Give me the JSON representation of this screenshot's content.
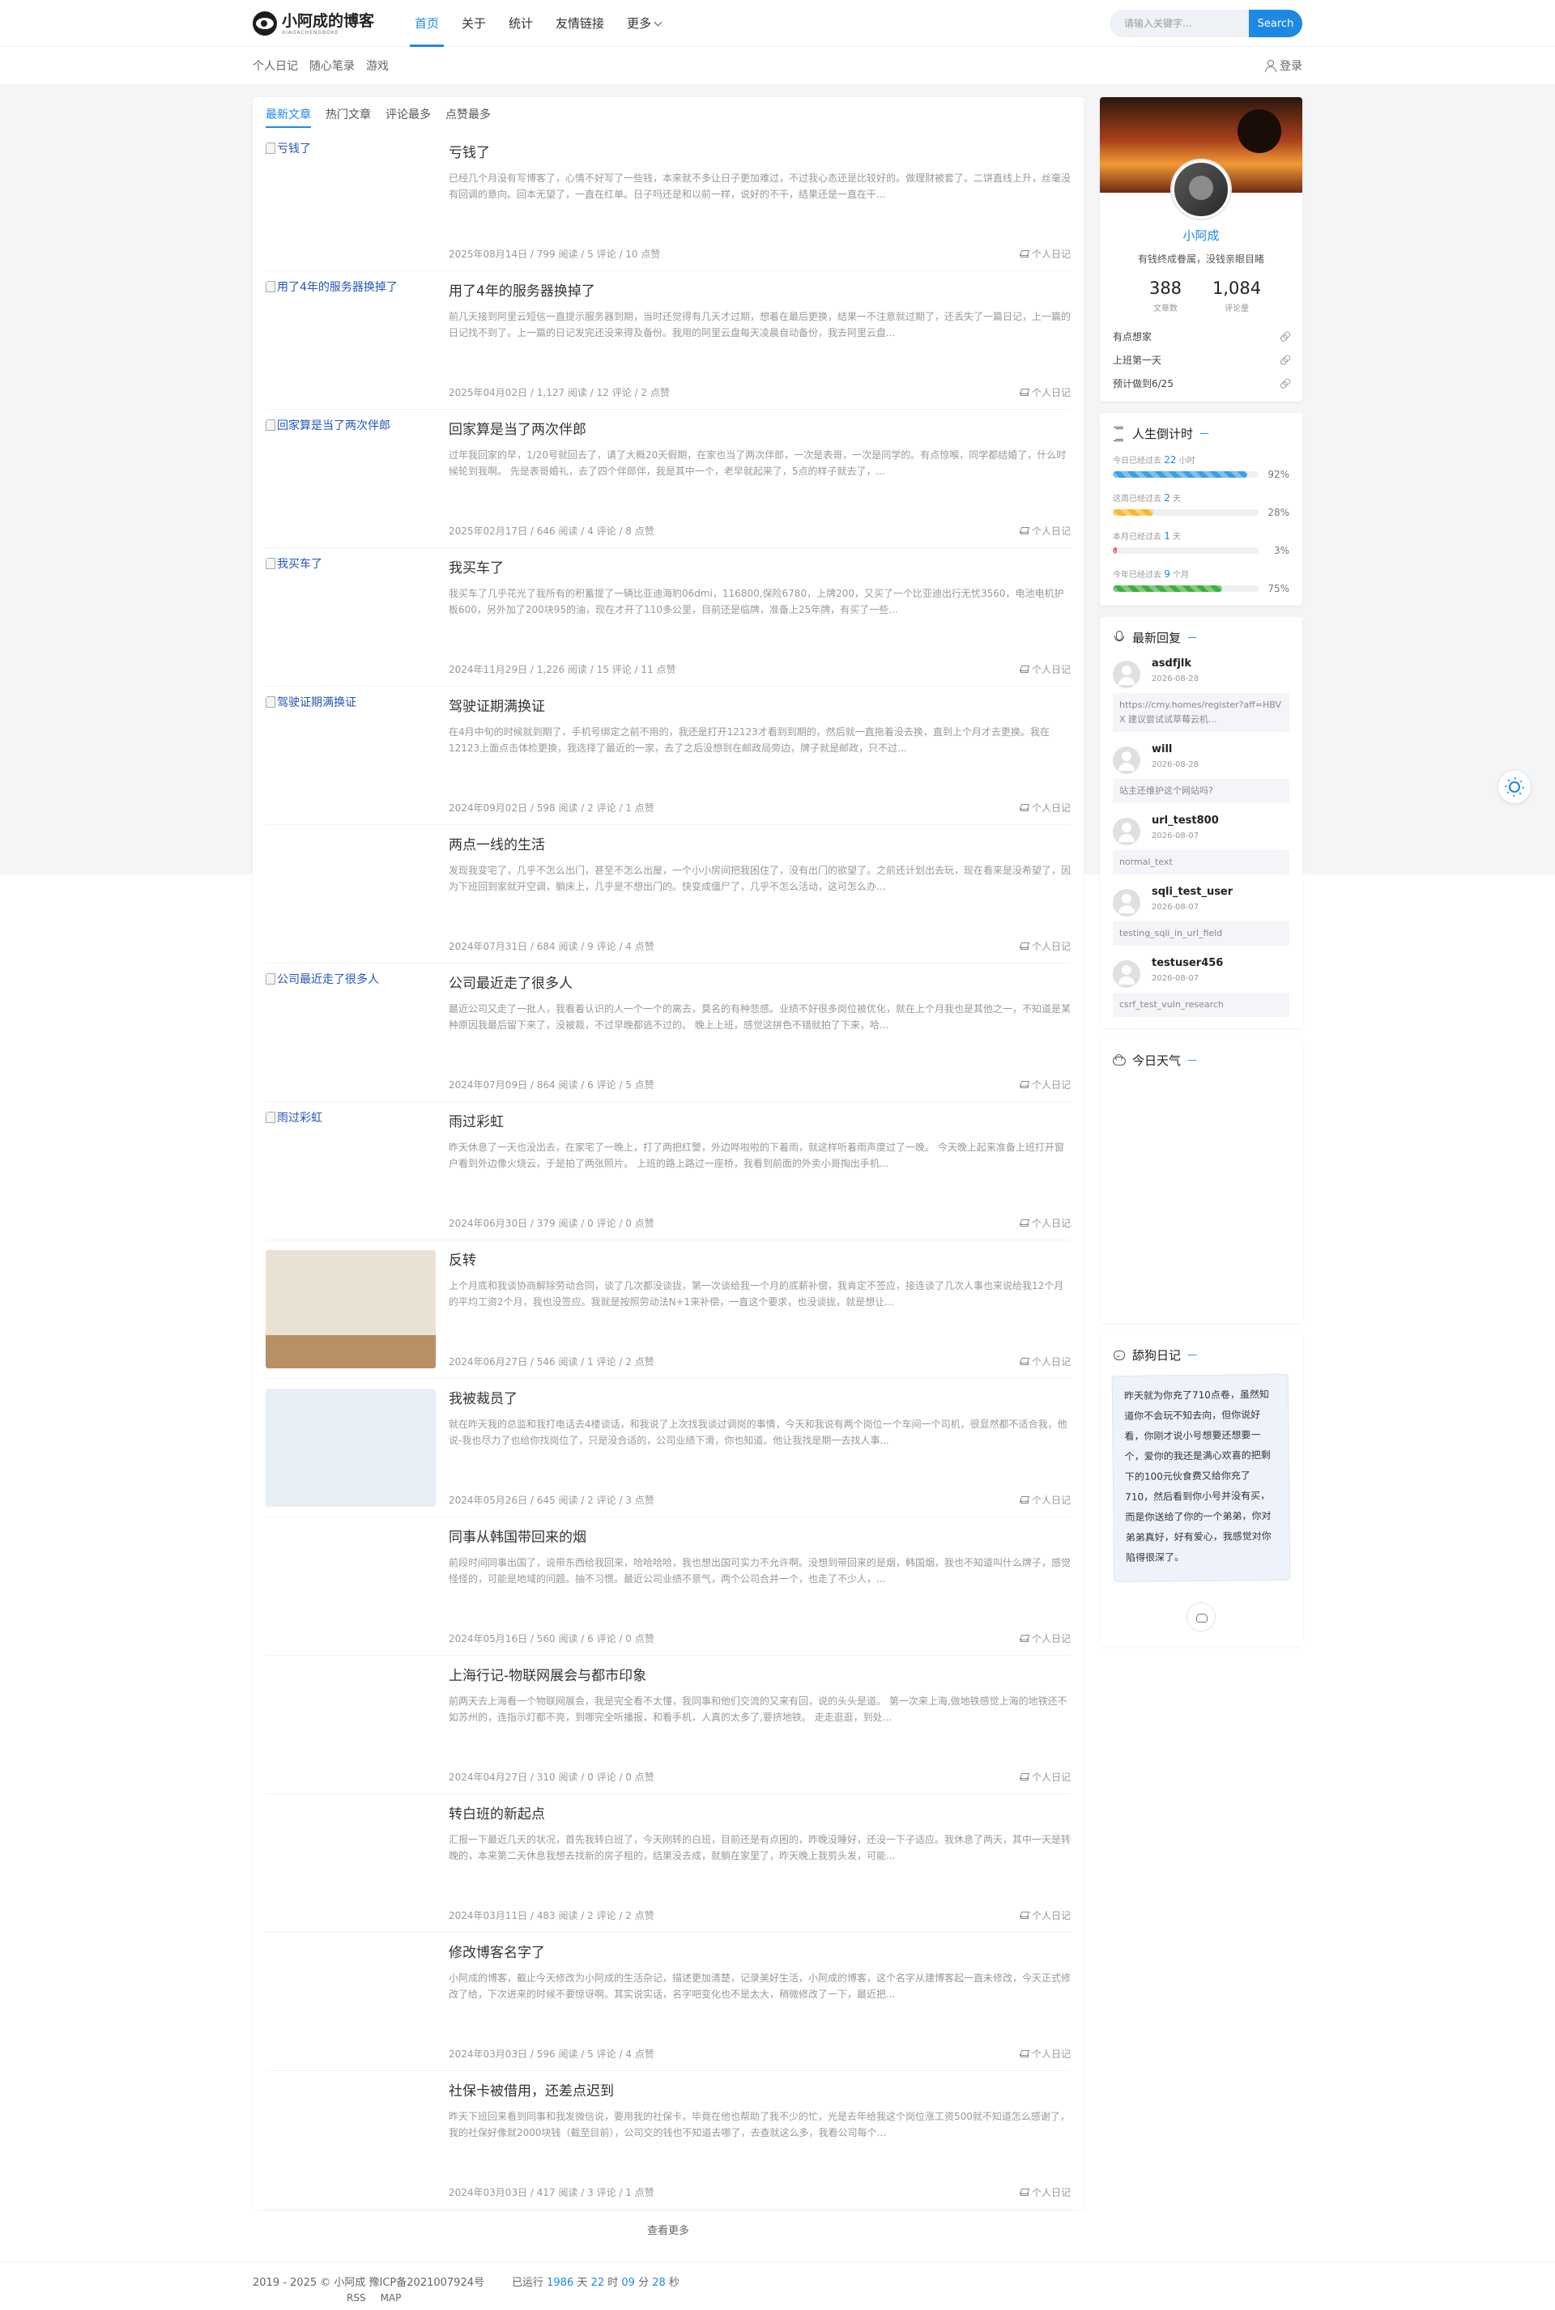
{
  "header": {
    "logo_title": "小阿成的博客",
    "logo_sub": "XIAOACHENGBOKE",
    "nav": [
      {
        "label": "首页",
        "active": true
      },
      {
        "label": "关于"
      },
      {
        "label": "统计"
      },
      {
        "label": "友情链接"
      },
      {
        "label": "更多"
      }
    ],
    "search_placeholder": "请输入关键字...",
    "search_button": "Search"
  },
  "subnav": {
    "items": [
      "个人日记",
      "随心笔录",
      "游戏"
    ],
    "login": "登录"
  },
  "tabs": [
    "最新文章",
    "热门文章",
    "评论最多",
    "点赞最多"
  ],
  "posts": [
    {
      "thumb_alt": "亏钱了",
      "thumb": "broken",
      "title": "亏钱了",
      "excerpt": "已经几个月没有写博客了，心情不好写了一些钱，本来就不多让日子更加难过，不过我心态还是比较好的。做理财被套了。二饼直线上升，丝毫没有回调的意向。回本无望了，一直在红单。日子吗还是和以前一样，说好的不干，结果还是一直在干...",
      "date": "2025年08月14日",
      "views": "799 阅读",
      "comments": "5 评论",
      "likes": "10 点赞",
      "category": "个人日记"
    },
    {
      "thumb_alt": "用了4年的服务器换掉了",
      "thumb": "broken",
      "title": "用了4年的服务器换掉了",
      "excerpt": "前几天接到阿里云短信一直提示服务器到期，当时还觉得有几天才过期，想着在最后更换，结果一不注意就过期了，还丢失了一篇日记，上一篇的日记找不到了。上一篇的日记发完还没来得及备份。我用的阿里云盘每天凌晨自动备份，我去阿里云盘...",
      "date": "2025年04月02日",
      "views": "1,127 阅读",
      "comments": "12 评论",
      "likes": "2 点赞",
      "category": "个人日记"
    },
    {
      "thumb_alt": "回家算是当了两次伴郎",
      "thumb": "broken",
      "title": "回家算是当了两次伴郎",
      "excerpt": "过年我回家的早，1/20号就回去了，请了大概20天假期，在家也当了两次伴郎，一次是表哥，一次是同学的。有点惊喉，同学都结婚了，什么时候轮到我啊。 先是表哥婚礼，去了四个伴郎伴，我是其中一个，老早就起来了，5点的样子就去了，...",
      "date": "2025年02月17日",
      "views": "646 阅读",
      "comments": "4 评论",
      "likes": "8 点赞",
      "category": "个人日记"
    },
    {
      "thumb_alt": "我买车了",
      "thumb": "broken",
      "title": "我买车了",
      "excerpt": "我买车了几乎花光了我所有的积蓄提了一辆比亚迪海豹06dmi，116800,保险6780，上牌200，又买了一个比亚迪出行无忧3560，电池电机护板600，另外加了200块95的油，现在才开了110多公里，目前还是临牌，准备上25年牌，有买了一些...",
      "date": "2024年11月29日",
      "views": "1,226 阅读",
      "comments": "15 评论",
      "likes": "11 点赞",
      "category": "个人日记"
    },
    {
      "thumb_alt": "驾驶证期满换证",
      "thumb": "broken",
      "title": "驾驶证期满换证",
      "excerpt": "在4月中旬的时候就到期了，手机号绑定之前不用的，我还是打开12123才看到到期的，然后就一直拖着没去换，直到上个月才去更换。我在12123上面点击体检更换，我选择了最近的一家，去了之后没想到在邮政局旁边，牌子就是邮政，只不过...",
      "date": "2024年09月02日",
      "views": "598 阅读",
      "comments": "2 评论",
      "likes": "1 点赞",
      "category": "个人日记"
    },
    {
      "thumb_alt": "两点一线的生活",
      "thumb": "art1",
      "title": "两点一线的生活",
      "excerpt": "发现我变宅了，几乎不怎么出门，甚至不怎么出屋，一个小小房间把我困住了，没有出门的欲望了。之前还计划出去玩，现在看来是没希望了，因为下班回到家就开空调，躺床上，几乎是不想出门的。快变成僵尸了，几乎不怎么活动，这可怎么办...",
      "date": "2024年07月31日",
      "views": "684 阅读",
      "comments": "9 评论",
      "likes": "4 点赞",
      "category": "个人日记"
    },
    {
      "thumb_alt": "公司最近走了很多人",
      "thumb": "broken",
      "title": "公司最近走了很多人",
      "excerpt": "最近公司又走了一批人，我看着认识的人一个一个的离去，莫名的有种悲感。业绩不好很多岗位被优化，就在上个月我也是其他之一，不知道是某种原因我最后留下来了，没被裁，不过早晚都逃不过的。 晚上上班，感觉这拼色不错就拍了下来，哈...",
      "date": "2024年07月09日",
      "views": "864 阅读",
      "comments": "6 评论",
      "likes": "5 点赞",
      "category": "个人日记"
    },
    {
      "thumb_alt": "雨过彩虹",
      "thumb": "broken",
      "title": "雨过彩虹",
      "excerpt": "昨天休息了一天也没出去，在家宅了一晚上，打了两把红警，外边哗啦啦的下着雨，就这样听着雨声度过了一晚。 今天晚上起来准备上班打开窗户看到外边像火烧云，于是拍了两张照片。 上班的路上路过一座桥，我看到前面的外卖小哥掏出手机...",
      "date": "2024年06月30日",
      "views": "379 阅读",
      "comments": "0 评论",
      "likes": "0 点赞",
      "category": "个人日记"
    },
    {
      "thumb_alt": "反转",
      "thumb": "art2",
      "title": "反转",
      "excerpt": "上个月底和我谈协商解除劳动合同，谈了几次都没谈拢，第一次谈给我一个月的底薪补偿，我肯定不签应，接连谈了几次人事也来说给我12个月的平均工资2个月，我也没签应。我就是按照劳动法N+1来补偿，一直这个要求，也没谈拢，就是想让...",
      "date": "2024年06月27日",
      "views": "546 阅读",
      "comments": "1 评论",
      "likes": "2 点赞",
      "category": "个人日记"
    },
    {
      "thumb_alt": "我被裁员了",
      "thumb": "art3",
      "title": "我被裁员了",
      "excerpt": "就在昨天我的总监和我打电话去4楼谈话，和我说了上次找我谈过调岗的事情，今天和我说有两个岗位一个车间一个司机，很显然都不适合我，他说-我也尽力了也给你找岗位了，只是没合适的，公司业绩下滑，你也知道。他让我找是期一去找人事...",
      "date": "2024年05月26日",
      "views": "645 阅读",
      "comments": "2 评论",
      "likes": "3 点赞",
      "category": "个人日记"
    },
    {
      "thumb_alt": "",
      "thumb": "none",
      "title": "同事从韩国带回来的烟",
      "excerpt": "前段时间同事出国了，说带东西给我回来，哈哈哈哈，我也想出国可实力不允许啊。没想到带回来的是烟，韩国烟，我也不知道叫什么牌子，感觉怪怪的，可能是地域的问题。抽不习惯。最近公司业绩不景气，两个公司合并一个，也走了不少人，...",
      "date": "2024年05月16日",
      "views": "560 阅读",
      "comments": "6 评论",
      "likes": "0 点赞",
      "category": "个人日记"
    },
    {
      "thumb_alt": "",
      "thumb": "none",
      "title": "上海行记-物联网展会与都市印象",
      "excerpt": "前两天去上海看一个物联网展会，我是完全看不太懂，我同事和他们交流的又来有回，说的头头是道。 第一次来上海,做地铁感觉上海的地铁还不如苏州的，连指示灯都不亮，到哪完全听播报，和看手机，人真的太多了,要挤地铁。 走走逛逛，到处...",
      "date": "2024年04月27日",
      "views": "310 阅读",
      "comments": "0 评论",
      "likes": "0 点赞",
      "category": "个人日记"
    },
    {
      "thumb_alt": "",
      "thumb": "none",
      "title": "转白班的新起点",
      "excerpt": "汇报一下最近几天的状况，首先我转白班了，今天刚转的白班，目前还是有点困的，昨晚没睡好，还没一下子适应。我休息了两天，其中一天是转晚的，本来第二天休息我想去找新的房子租的，结果没去成，就躺在家里了，昨天晚上我剪头发，可能...",
      "date": "2024年03月11日",
      "views": "483 阅读",
      "comments": "2 评论",
      "likes": "2 点赞",
      "category": "个人日记"
    },
    {
      "thumb_alt": "",
      "thumb": "none",
      "title": "修改博客名字了",
      "excerpt": "小阿成的博客，截止今天修改为小阿成的生活杂记，描述更加清楚，记录美好生活，小阿成的博客，这个名字从建博客起一直未修改，今天正式修改了给，下次进来的时候不要惊讶啊。其实说实话，名字吧变化也不是太大，稍微修改了一下，最近把...",
      "date": "2024年03月03日",
      "views": "596 阅读",
      "comments": "5 评论",
      "likes": "4 点赞",
      "category": "个人日记"
    },
    {
      "thumb_alt": "",
      "thumb": "none",
      "title": "社保卡被借用，还差点迟到",
      "excerpt": "昨天下班回来看到同事和我发微信说，要用我的社保卡，毕竟在他也帮助了我不少的忙，光是去年给我这个岗位涨工资500就不知道怎么感谢了， 我的社保好像就2000块钱（截至目前），公司交的钱也不知道去哪了，去查就这么多，我看公司每个...",
      "date": "2024年03月03日",
      "views": "417 阅读",
      "comments": "3 评论",
      "likes": "1 点赞",
      "category": "个人日记"
    }
  ],
  "load_more": "查看更多",
  "profile": {
    "name": "小阿成",
    "motto": "有钱终成眷属，没钱亲眼目睹",
    "posts_count": "388",
    "posts_label": "文章数",
    "comments_count": "1,084",
    "comments_label": "评论量",
    "links": [
      "有点想家",
      "上班第一天",
      "预计做到6/25"
    ]
  },
  "life": {
    "title": "人生倒计时",
    "rows": [
      {
        "prefix": "今日已经过去",
        "value": "22",
        "unit": "小时",
        "percent": 92,
        "pct_label": "92%",
        "color": "#3aa0e8"
      },
      {
        "prefix": "这周已经过去",
        "value": "2",
        "unit": "天",
        "percent": 28,
        "pct_label": "28%",
        "color": "#f5b82e"
      },
      {
        "prefix": "本月已经过去",
        "value": "1",
        "unit": "天",
        "percent": 3,
        "pct_label": "3%",
        "color": "#e84b4b"
      },
      {
        "prefix": "今年已经过去",
        "value": "9",
        "unit": "个月",
        "percent": 75,
        "pct_label": "75%",
        "color": "#3fae3f"
      }
    ]
  },
  "replies": {
    "title": "最新回复",
    "items": [
      {
        "name": "asdfjlk",
        "date": "2026-08-28",
        "text": "https://cmy.homes/register?aff=HBVX 建议尝试试草莓云机..."
      },
      {
        "name": "will",
        "date": "2026-08-28",
        "text": "站主还维护这个网站吗?"
      },
      {
        "name": "url_test800",
        "date": "2026-08-07",
        "text": "normal_text"
      },
      {
        "name": "sqli_test_user",
        "date": "2026-08-07",
        "text": "testing_sqli_in_url_field"
      },
      {
        "name": "testuser456",
        "date": "2026-08-07",
        "text": "csrf_test_vuln_research"
      }
    ]
  },
  "weather": {
    "title": "今日天气"
  },
  "diary": {
    "title": "舔狗日记",
    "text": "昨天就为你充了710点卷，虽然知道你不会玩不知去向，但你说好看，你刚才说小号想要还想要一个，爱你的我还是满心欢喜的把剩下的100元伙食费又给你充了710，然后看到你小号并没有买，而是你送给了你的一个弟弟，你对弟弟真好，好有爱心，我感觉对你陷得很深了。"
  },
  "footer": {
    "copyright": "2019 - 2025 © 小阿成 豫ICP备2021007924号",
    "rss": "RSS",
    "map": "MAP",
    "run_prefix": "已运行",
    "days": "1986",
    "days_unit": "天",
    "hours": "22",
    "hours_unit": "时",
    "minutes": "09",
    "minutes_unit": "分",
    "seconds": "28",
    "seconds_unit": "秒"
  },
  "colors": {
    "accent": "#1e88e5"
  }
}
